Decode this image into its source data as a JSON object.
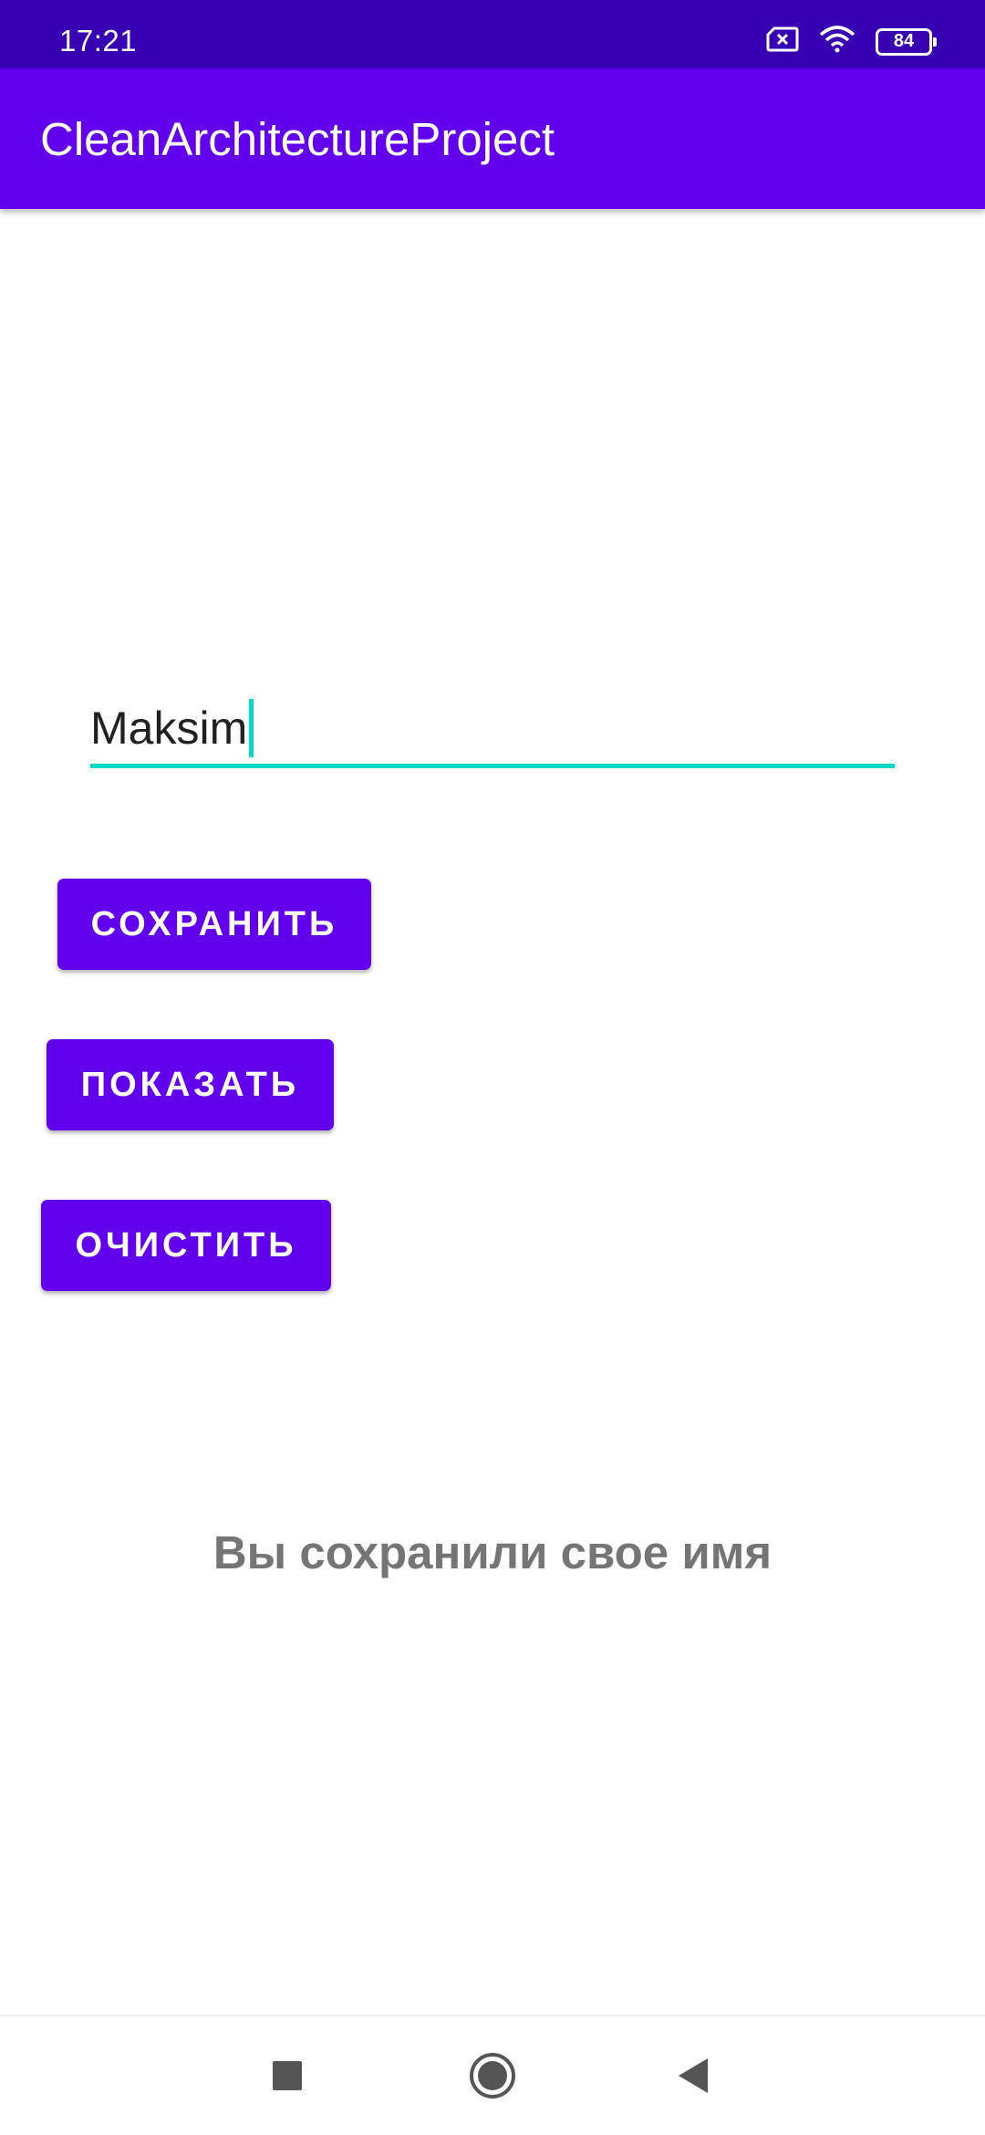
{
  "status_bar": {
    "time": "17:21",
    "battery_level": "84",
    "icons": [
      "sim-error-icon",
      "wifi-icon",
      "battery-icon"
    ],
    "background_color": "#3700B3"
  },
  "app_bar": {
    "title": "CleanArchitectureProject",
    "background_color": "#6200EE"
  },
  "name_input": {
    "value": "Maksim",
    "accent_color": "#03DAC5"
  },
  "buttons": {
    "save_label": "СОХРАНИТЬ",
    "show_label": "ПОКАЗАТЬ",
    "clear_label": "ОЧИСТИТЬ",
    "color": "#6200EE"
  },
  "result": {
    "text": "Вы сохранили свое имя"
  },
  "nav_bar": {
    "icons": [
      "recents-square-icon",
      "home-circle-icon",
      "back-triangle-icon"
    ]
  }
}
